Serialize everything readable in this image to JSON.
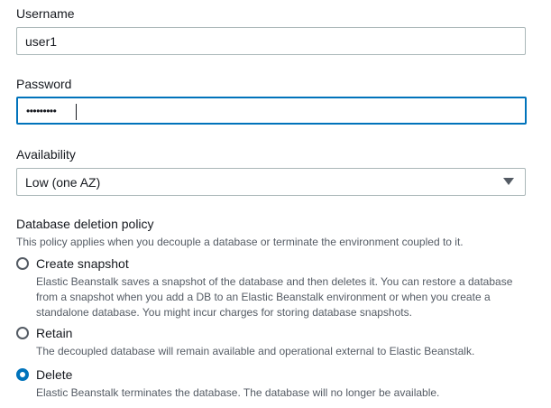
{
  "username": {
    "label": "Username",
    "value": "user1"
  },
  "password": {
    "label": "Password",
    "masked_value": "•••••••••"
  },
  "availability": {
    "label": "Availability",
    "selected": "Low (one AZ)"
  },
  "deletion_policy": {
    "title": "Database deletion policy",
    "description": "This policy applies when you decouple a database or terminate the environment coupled to it.",
    "selected": "Delete",
    "options": [
      {
        "label": "Create snapshot",
        "desc_lines": [
          "Elastic Beanstalk saves a snapshot of the database and then deletes it. You can restore a database",
          "from a snapshot when you add a DB to an Elastic Beanstalk environment or when you create a",
          "standalone database. You might incur charges for storing database snapshots."
        ]
      },
      {
        "label": "Retain",
        "desc_lines": [
          "The decoupled database will remain available and operational external to Elastic Beanstalk."
        ]
      },
      {
        "label": "Delete",
        "desc_lines": [
          "Elastic Beanstalk terminates the database. The database will no longer be available."
        ]
      }
    ]
  },
  "colors": {
    "focus": "#0073bb",
    "border": "#aab7b8",
    "text": "#16191f",
    "secondary_text": "#545b64"
  }
}
